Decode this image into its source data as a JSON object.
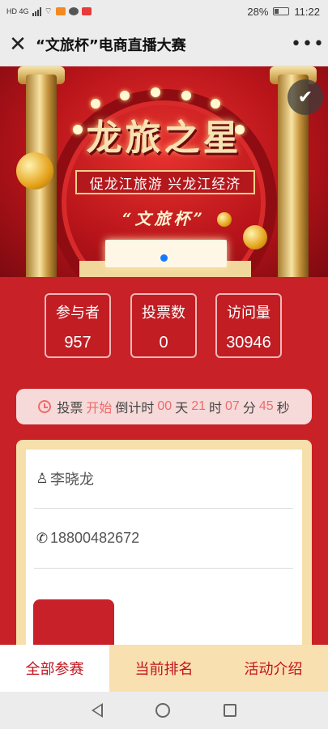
{
  "status_bar": {
    "network": "HD 4G",
    "battery_percent": "28%",
    "time": "11:22",
    "icons": [
      "signal-icon",
      "wifi-icon",
      "app-icon-orange",
      "chat-icon",
      "app-icon-red"
    ]
  },
  "title_bar": {
    "close_glyph": "✕",
    "title": "“文旅杯”电商直播大赛",
    "more_glyph": "•••"
  },
  "banner": {
    "title": "龙旅之星",
    "slogan": "促龙江旅游  兴龙江经济",
    "subtitle": "“文旅杯”",
    "colors": {
      "primary": "#c82127",
      "gold": "#f6e2b2",
      "indicator": "#1677ff"
    }
  },
  "stats": [
    {
      "label": "参与者",
      "value": "957"
    },
    {
      "label": "投票数",
      "value": "0"
    },
    {
      "label": "访问量",
      "value": "30946"
    }
  ],
  "countdown": {
    "prefix": "投票",
    "state": "开始",
    "label": "倒计时",
    "days": "00",
    "days_unit": "天",
    "hours": "21",
    "hours_unit": "时",
    "minutes": "07",
    "minutes_unit": "分",
    "seconds": "45",
    "seconds_unit": "秒"
  },
  "card": {
    "name": "李晓龙",
    "phone": "18800482672"
  },
  "tabs": [
    {
      "label": "全部参赛",
      "active": true
    },
    {
      "label": "当前排名",
      "active": false
    },
    {
      "label": "活动介绍",
      "active": false
    }
  ]
}
